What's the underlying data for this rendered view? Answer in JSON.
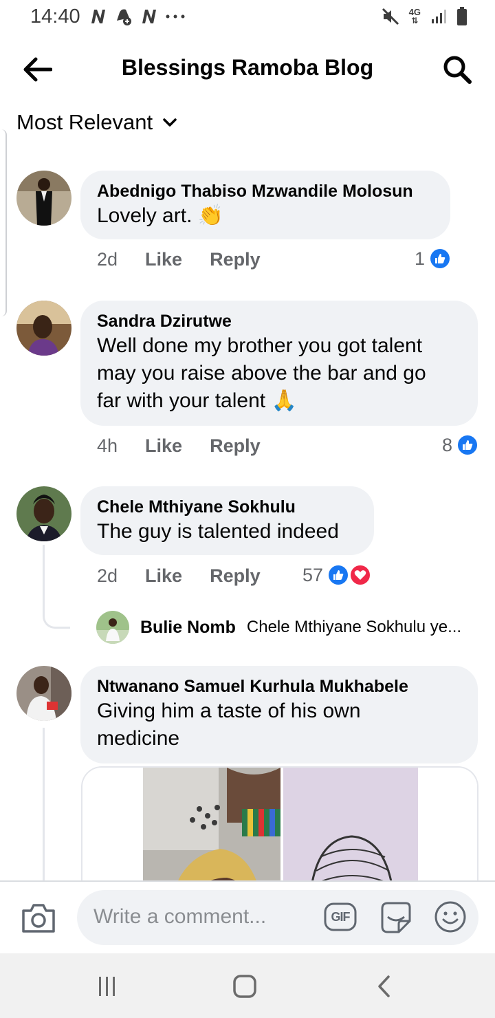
{
  "status_bar": {
    "time": "14:40",
    "notifications": [
      "n-logo-icon",
      "notification-badge-icon",
      "n-logo-icon",
      "more-dots-icon"
    ],
    "network": "4G",
    "icons": [
      "mute-icon",
      "network-4g-icon",
      "signal-icon",
      "battery-icon"
    ]
  },
  "header": {
    "title": "Blessings Ramoba Blog",
    "back_icon": "arrow-left-icon",
    "search_icon": "search-icon"
  },
  "sort": {
    "label": "Most Relevant",
    "icon": "chevron-down-icon"
  },
  "comments": [
    {
      "name": "Abednigo Thabiso Mzwandile Molosun",
      "text": "Lovely art.",
      "emoji": "👏",
      "time": "2d",
      "like_label": "Like",
      "reply_label": "Reply",
      "reaction_count": "1",
      "reactions": [
        "like"
      ]
    },
    {
      "name": "Sandra Dzirutwe",
      "text_lines": [
        "Well done my brother you got talent",
        "may you raise above the bar and go",
        "far with your talent"
      ],
      "emoji": "🙏",
      "time": "4h",
      "like_label": "Like",
      "reply_label": "Reply",
      "reaction_count": "8",
      "reactions": [
        "like"
      ]
    },
    {
      "name": "Chele Mthiyane Sokhulu",
      "text": "The guy is talented indeed",
      "time": "2d",
      "like_label": "Like",
      "reply_label": "Reply",
      "reaction_count": "57",
      "reactions": [
        "like",
        "love"
      ],
      "reply_preview": {
        "name": "Bulie Nomb",
        "text": "Chele Mthiyane Sokhulu ye..."
      }
    },
    {
      "name": "Ntwanano Samuel Kurhula Mukhabele",
      "text_lines": [
        "Giving him a taste of his own",
        "medicine"
      ]
    }
  ],
  "composer": {
    "placeholder": "Write a comment...",
    "gif_label": "GIF",
    "icons": [
      "camera-icon",
      "gif-icon",
      "sticker-icon",
      "emoji-icon"
    ]
  },
  "colors": {
    "facebook_blue": "#1877f2",
    "love_red": "#f02849",
    "bubble_bg": "#f0f2f5",
    "secondary_text": "#65676b"
  }
}
